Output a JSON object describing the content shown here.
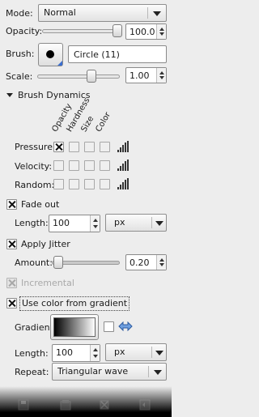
{
  "mode": {
    "label": "Mode:",
    "value": "Normal"
  },
  "opacity": {
    "label": "Opacity:",
    "value": "100.0",
    "fraction": 1.0
  },
  "brush": {
    "label": "Brush:",
    "name": "Circle (11)"
  },
  "scale": {
    "label": "Scale:",
    "value": "1.00",
    "fraction": 0.5
  },
  "dynamics": {
    "title": "Brush Dynamics",
    "columns": [
      "Opacity",
      "Hardness",
      "Size",
      "Color"
    ],
    "rows": [
      {
        "label": "Pressure:",
        "checked": [
          true,
          false,
          false,
          false
        ]
      },
      {
        "label": "Velocity:",
        "checked": [
          false,
          false,
          false,
          false
        ]
      },
      {
        "label": "Random:",
        "checked": [
          false,
          false,
          false,
          false
        ]
      }
    ]
  },
  "fade": {
    "label": "Fade out",
    "checked": true,
    "length_label": "Length:",
    "length_value": "100",
    "unit": "px"
  },
  "jitter": {
    "label": "Apply Jitter",
    "checked": true,
    "amount_label": "Amount:",
    "amount_value": "0.20",
    "fraction": 0.02
  },
  "incremental": {
    "label": "Incremental",
    "checked": true,
    "disabled": true
  },
  "gradient_opt": {
    "label": "Use color from gradient",
    "checked": true,
    "gradient_label": "Gradient:",
    "reverse_checked": false,
    "length_label": "Length:",
    "length_value": "100",
    "unit": "px",
    "repeat_label": "Repeat:",
    "repeat_value": "Triangular wave"
  },
  "bottom_icons": [
    "save-icon",
    "restore-icon",
    "delete-icon",
    "reset-icon"
  ]
}
